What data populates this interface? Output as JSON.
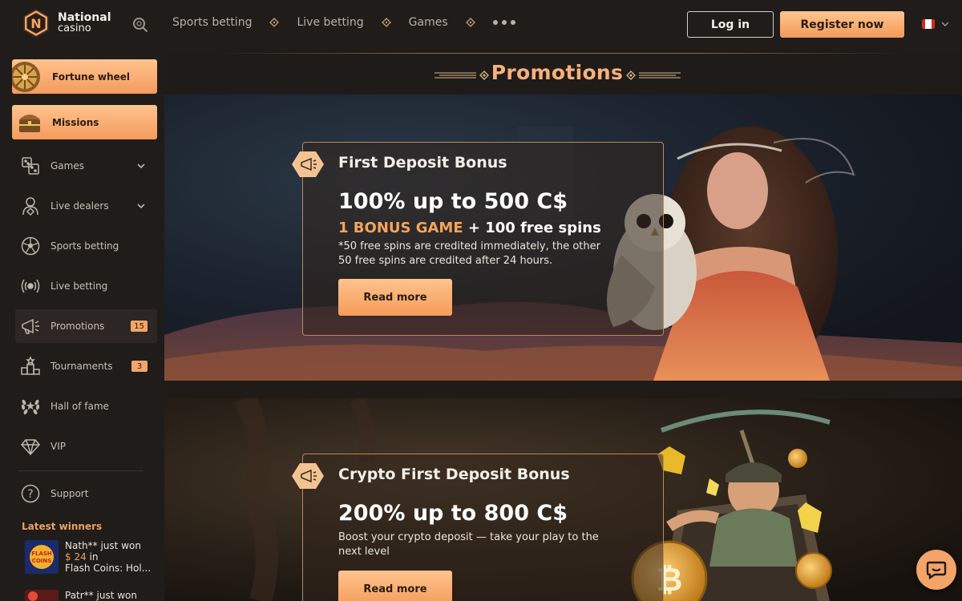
{
  "brand": {
    "name_line1": "National",
    "name_line2": "casino",
    "logo_letter": "N"
  },
  "topnav": {
    "search_icon": "search-icon",
    "links": [
      "Sports betting",
      "Live betting",
      "Games"
    ],
    "more_icon": "more-dots-icon"
  },
  "auth": {
    "login_label": "Log in",
    "register_label": "Register now"
  },
  "language": {
    "flag": "canada-flag-icon",
    "chevron": "chevron-down-icon"
  },
  "sidebar": {
    "promo_tiles": [
      {
        "label": "Fortune wheel",
        "icon": "fortune-wheel-icon"
      },
      {
        "label": "Missions",
        "icon": "treasure-chest-icon"
      }
    ],
    "items": [
      {
        "label": "Games",
        "icon": "games-icon",
        "has_chevron": true
      },
      {
        "label": "Live dealers",
        "icon": "live-dealer-icon",
        "has_chevron": true
      },
      {
        "label": "Sports betting",
        "icon": "soccer-ball-icon"
      },
      {
        "label": "Live betting",
        "icon": "broadcast-icon"
      },
      {
        "label": "Promotions",
        "icon": "megaphone-icon",
        "badge": "15",
        "active": true
      },
      {
        "label": "Tournaments",
        "icon": "podium-icon",
        "badge": "3"
      },
      {
        "label": "Hall of fame",
        "icon": "laurel-icon"
      },
      {
        "label": "VIP",
        "icon": "diamond-icon"
      }
    ],
    "support_label": "Support",
    "latest_winners_title": "Latest winners",
    "winners": [
      {
        "name": "Nath** just won",
        "amount": "$ 24",
        "in_word": "in",
        "game": "Flash Coins: Hol..."
      },
      {
        "name": "Patr** just won"
      }
    ]
  },
  "main": {
    "title": "Promotions",
    "promos": [
      {
        "title": "First Deposit Bonus",
        "headline": "100% up to 500 C$",
        "sub_highlight": "1 BONUS GAME",
        "sub_rest": " + 100 free spins",
        "description": "*50 free spins are credited immediately, the other 50 free spins are credited after 24 hours.",
        "button": "Read more"
      },
      {
        "title": "Crypto First Deposit Bonus",
        "headline": "200% up to 800 C$",
        "description": "Boost your crypto deposit — take your play to the next level",
        "button": "Read more"
      }
    ]
  },
  "chat": {
    "icon": "chat-bubble-icon"
  },
  "colors": {
    "accent": "#f39b5a",
    "accent_light": "#ffc38d",
    "bg": "#1e1b19",
    "title": "#f7b07a"
  }
}
